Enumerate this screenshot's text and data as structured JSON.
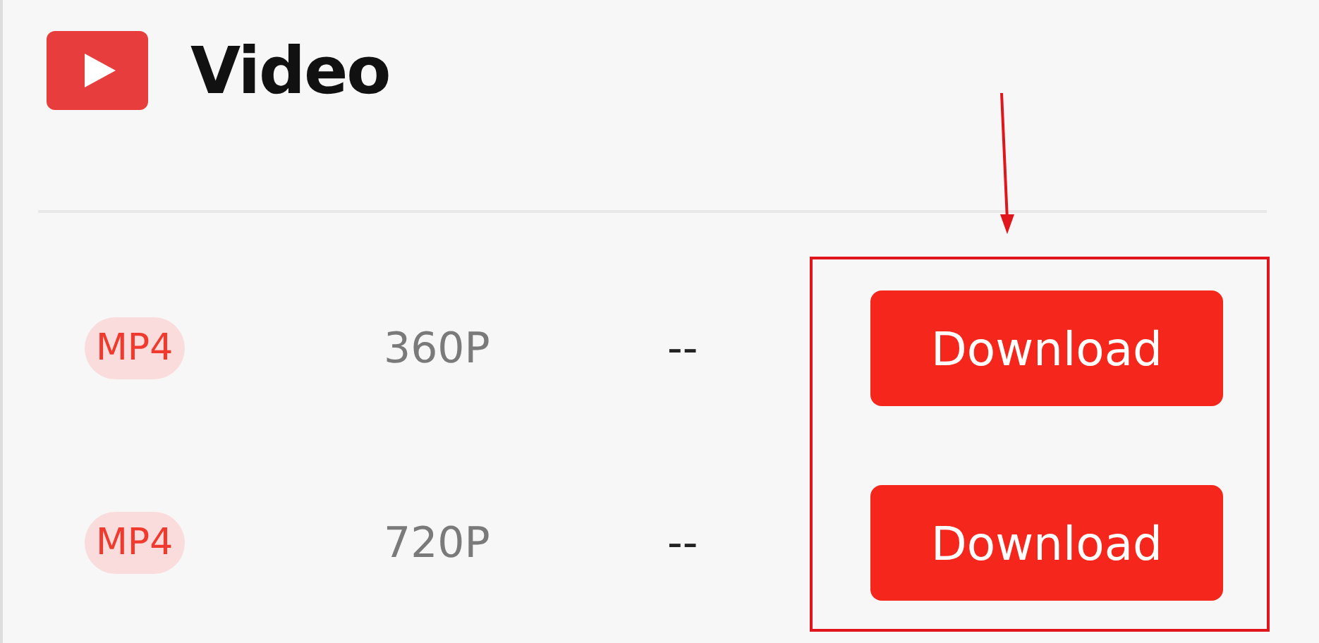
{
  "header": {
    "title": "Video"
  },
  "rows": [
    {
      "format": "MP4",
      "quality": "360P",
      "size": "--",
      "button": "Download"
    },
    {
      "format": "MP4",
      "quality": "720P",
      "size": "--",
      "button": "Download"
    }
  ]
}
